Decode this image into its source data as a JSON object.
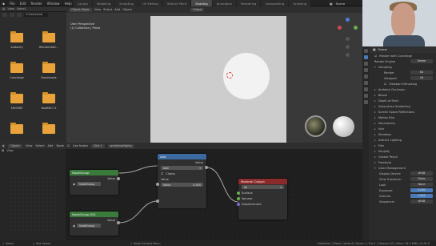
{
  "app_menu": [
    "File",
    "Edit",
    "Render",
    "Window",
    "Help"
  ],
  "workspace_tabs": [
    "Layout",
    "Modeling",
    "Sculpting",
    "UV Editing",
    "Texture Paint",
    "Shading",
    "Animation",
    "Rendering",
    "Compositing",
    "Scripting"
  ],
  "active_tab": "Shading",
  "scene_label": "Scene",
  "file_browser": {
    "view_label": "View",
    "select_label": "Select",
    "path": "C:\\Users\\Lab",
    "folders": [
      "Audacity",
      "BlenderAdd...",
      "Concierge",
      "Downloads",
      "FAVORIE",
      "KoalMic7.5",
      "",
      ""
    ]
  },
  "viewport": {
    "mode": "Object Mode",
    "menu": [
      "View",
      "Select",
      "Add",
      "Object"
    ],
    "shading": "Global",
    "info_line1": "User Perspective",
    "info_line2": "(1) Collection | Plane"
  },
  "node_editor": {
    "header": [
      "Object",
      "View",
      "Select",
      "Add",
      "Node"
    ],
    "use_nodes": "Use Nodes",
    "slot": "Slot 1",
    "material": "worldmatfighty"
  },
  "nodes": {
    "group1": {
      "title": "NodeGroup",
      "value_label": "Value",
      "name": "NodeGroup"
    },
    "group2": {
      "title": "NodeGroup.001",
      "value_label": "Value",
      "name": "NodeGroup"
    },
    "add": {
      "title": "Add",
      "value_out": "Value",
      "op": "Add",
      "clamp": "Clamp",
      "value_in": "Value",
      "field_label": "Value",
      "field_value": "0.500"
    },
    "output": {
      "title": "Material Output",
      "target": "All",
      "surface": "Surface",
      "volume": "Volume",
      "displacement": "Displacement"
    }
  },
  "properties": {
    "scene": "Scene",
    "render_with_cam": "Render with Concierge",
    "render_engine_label": "Render Engine",
    "render_engine": "Eevee",
    "sampling": "Sampling",
    "render_label": "Render",
    "render_samples": "64",
    "viewport_label": "Viewport",
    "viewport_samples": "16",
    "viewport_denoise": "Viewport Denoising",
    "panels": [
      "Ambient Occlusion",
      "Bloom",
      "Depth of Field",
      "Subsurface Scattering",
      "Screen Space Reflections",
      "Motion Blur",
      "Volumetrics",
      "Hair",
      "Shadows",
      "Indirect Lighting",
      "Film",
      "Simplify",
      "Grease Pencil",
      "Freestyle",
      "Color Management"
    ],
    "display_device_label": "Display Device",
    "display_device": "sRGB",
    "view_transform_label": "View Transform",
    "view_transform": "Filmic",
    "look_label": "Look",
    "look": "None",
    "exposure_label": "Exposure",
    "exposure": "0.000",
    "gamma_label": "Gamma",
    "gamma": "1.000",
    "sequencer_label": "Sequencer",
    "sequencer": "sRGB"
  },
  "status": {
    "left": "Select",
    "mid": "Box Select",
    "right": "Node Context Menu",
    "info": "Collection | Plane | Verts:4 | Faces:1 | Tris:2 | Objects:1/2 | Mem: 34.5 MiB | v2.91.0"
  },
  "colors": {
    "accent": "#4a7ab8",
    "group_header": "#3a7a3a",
    "add_header": "#3a6aa0",
    "output_header": "#8a2a2a",
    "folder": "#e9a33a"
  }
}
